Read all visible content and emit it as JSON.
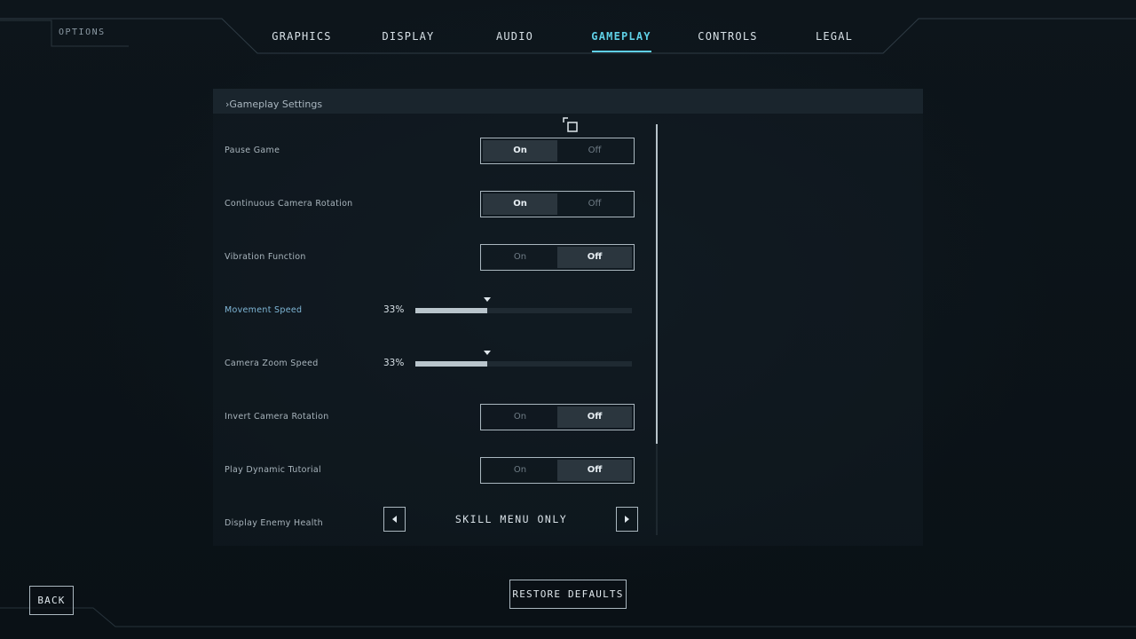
{
  "header": {
    "title": "OPTIONS",
    "tabs": [
      {
        "label": "GRAPHICS",
        "active": false
      },
      {
        "label": "DISPLAY",
        "active": false
      },
      {
        "label": "AUDIO",
        "active": false
      },
      {
        "label": "GAMEPLAY",
        "active": true
      },
      {
        "label": "CONTROLS",
        "active": false
      },
      {
        "label": "LEGAL",
        "active": false
      }
    ]
  },
  "panel": {
    "header": "›Gameplay Settings",
    "rows": [
      {
        "label": "Pause Game",
        "type": "toggle",
        "on": "On",
        "off": "Off",
        "selected": "On"
      },
      {
        "label": "Continuous Camera Rotation",
        "type": "toggle",
        "on": "On",
        "off": "Off",
        "selected": "On"
      },
      {
        "label": "Vibration Function",
        "type": "toggle",
        "on": "On",
        "off": "Off",
        "selected": "Off"
      },
      {
        "label": "Movement Speed",
        "type": "slider",
        "value_text": "33%",
        "value": 0.33
      },
      {
        "label": "Camera Zoom Speed",
        "type": "slider",
        "value_text": "33%",
        "value": 0.33
      },
      {
        "label": "Invert Camera Rotation",
        "type": "toggle",
        "on": "On",
        "off": "Off",
        "selected": "Off"
      },
      {
        "label": "Play Dynamic Tutorial",
        "type": "toggle",
        "on": "On",
        "off": "Off",
        "selected": "Off"
      },
      {
        "label": "Display Enemy Health",
        "type": "selector",
        "value": "SKILL MENU ONLY"
      }
    ]
  },
  "footer": {
    "back_label": "BACK",
    "restore_label": "RESTORE DEFAULTS"
  },
  "colors": {
    "accent": "#5fd0e6",
    "background": "#0b1217",
    "text": "#c7d3db"
  },
  "icons": [
    "move-icon",
    "arrow-left-icon",
    "arrow-right-icon",
    "slider-marker-icon"
  ]
}
